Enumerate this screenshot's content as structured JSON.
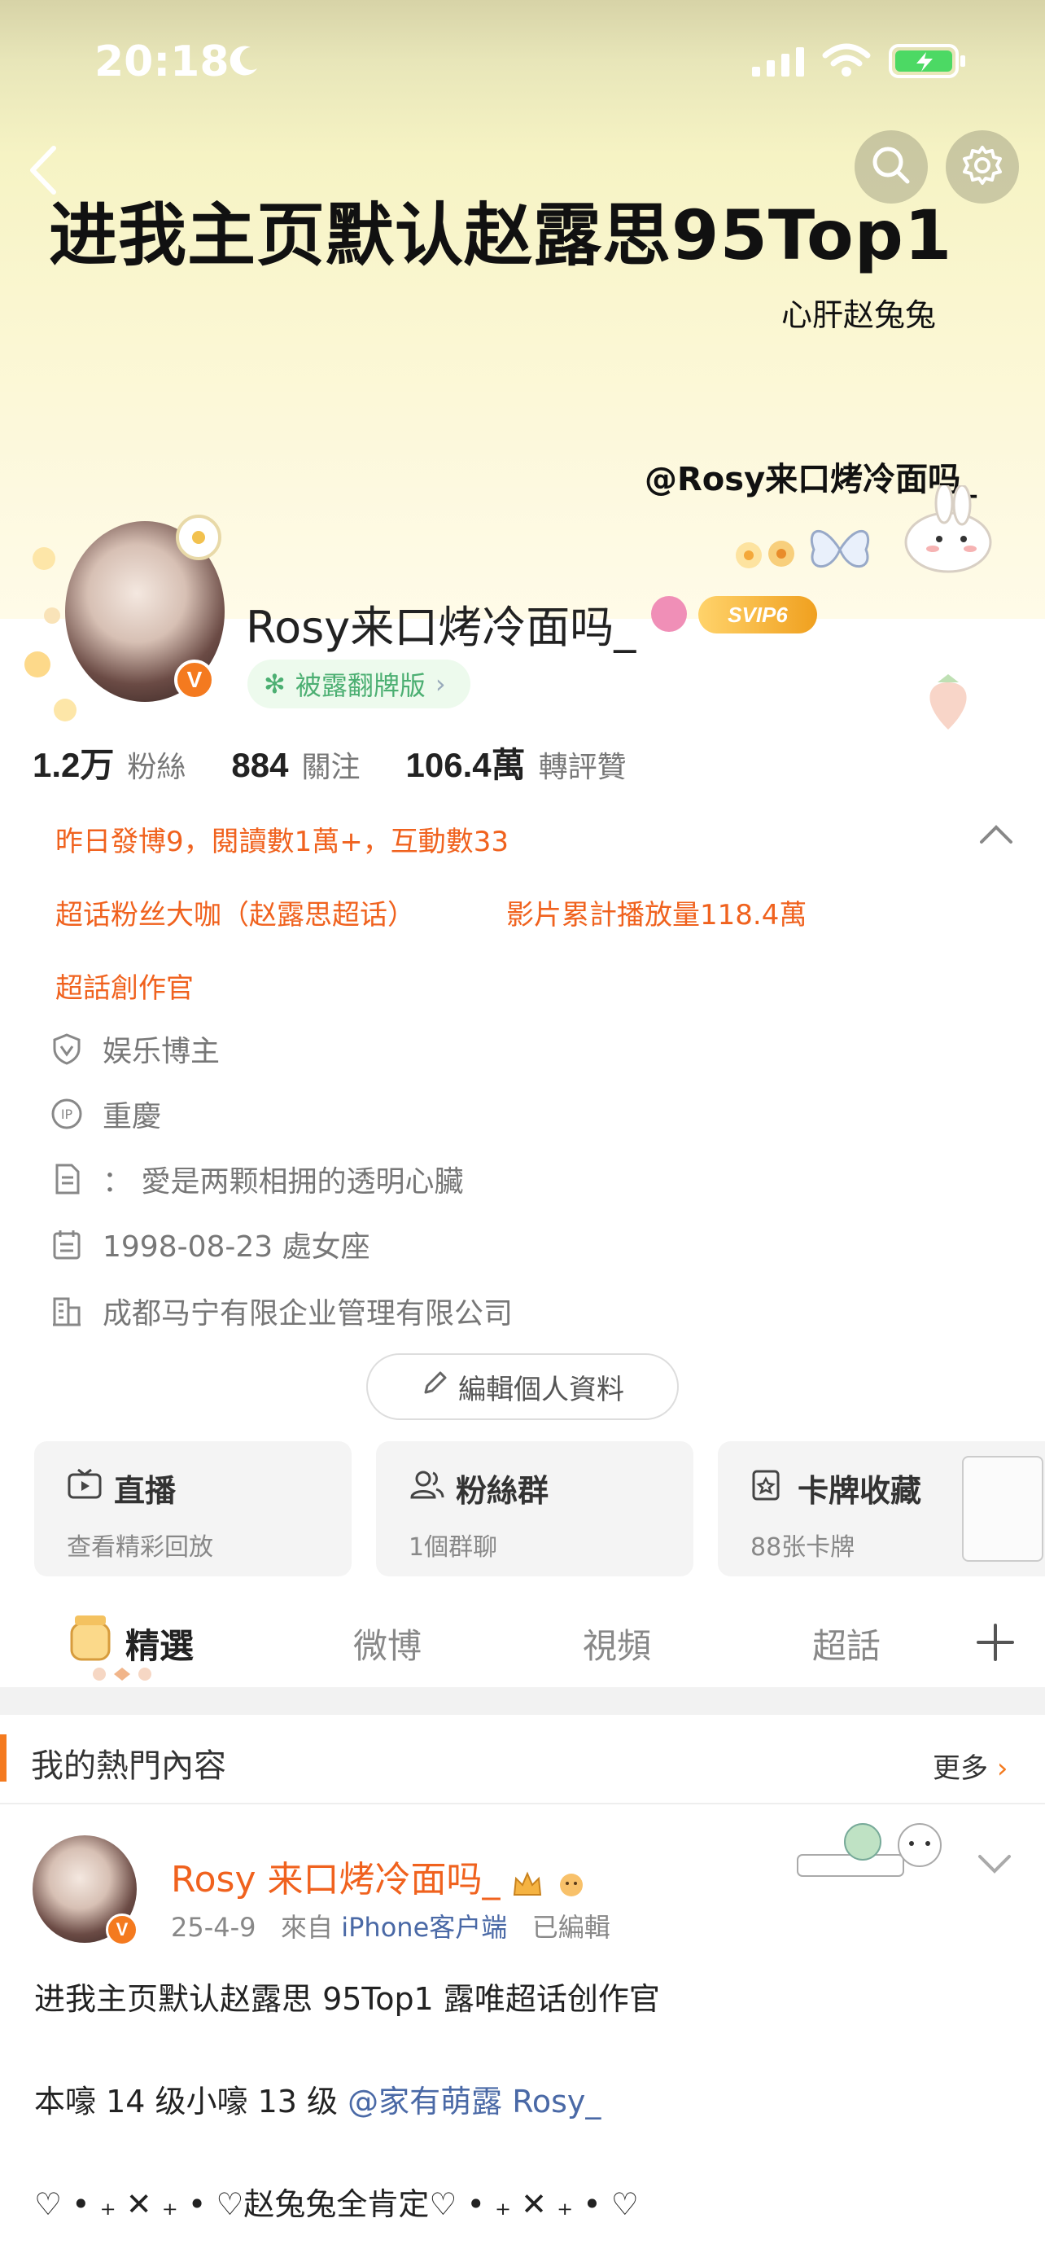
{
  "status_bar": {
    "time": "20:18"
  },
  "banner": {
    "headline": "进我主页默认赵露思95Top1",
    "subline": "心肝赵兔兔",
    "handle": "@Rosy来口烤冷面吗_"
  },
  "profile": {
    "username": "Rosy来口烤冷面吗_",
    "svip_label": "SVIP6",
    "fan_badge": "被露翻牌版",
    "stats": [
      {
        "value": "1.2万",
        "label": "粉絲"
      },
      {
        "value": "884",
        "label": "關注"
      },
      {
        "value": "106.4萬",
        "label": "轉評贊"
      }
    ]
  },
  "highlights": {
    "line1": "昨日發博9，閱讀數1萬+，互動數33",
    "line2a": "超话粉丝大咖（赵露思超话）",
    "line2b": "影片累計播放量118.4萬",
    "line3": "超話創作官"
  },
  "info": {
    "category": "娱乐博主",
    "ip": "重慶",
    "bio": "：  愛是两颗相拥的透明心臟",
    "birthday": "1998-08-23 處女座",
    "company": "成都马宁有限企业管理有限公司"
  },
  "edit_button": "編輯個人資料",
  "cards": [
    {
      "title": "直播",
      "sub": "查看精彩回放"
    },
    {
      "title": "粉絲群",
      "sub": "1個群聊"
    },
    {
      "title": "卡牌收藏",
      "sub": "88张卡牌"
    }
  ],
  "tabs": [
    "精選",
    "微博",
    "視頻",
    "超話"
  ],
  "hot": {
    "title": "我的熱門內容",
    "more": "更多"
  },
  "post": {
    "name": "Rosy 来口烤冷面吗_",
    "date": "25-4-9",
    "from": "來自",
    "source": "iPhone客户端",
    "edited": "已編輯",
    "line1": "进我主页默认赵露思 95Top1 露唯超话创作官",
    "line2_prefix": "本嚎 14 级小嚎 13 级 ",
    "line2_mention": "@家有萌露 Rosy_",
    "line3": "♡ • ₊ ✕ ₊ • ♡赵兔兔全肯定♡ • ₊ ✕ ₊ • ♡"
  },
  "colors": {
    "accent_orange": "#f0621e",
    "link_blue": "#4a69a6",
    "green_badge": "#4caf72"
  }
}
